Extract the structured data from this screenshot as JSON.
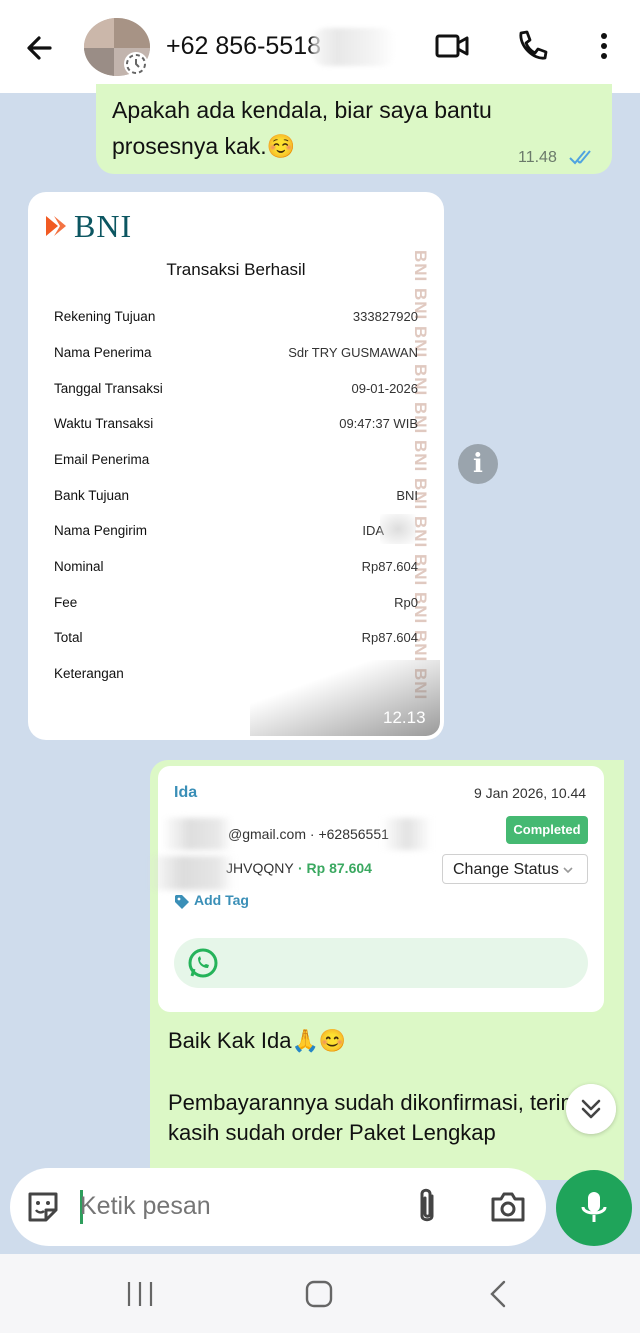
{
  "header": {
    "contact": "+62 856-5518",
    "icons": [
      "back-arrow-icon",
      "avatar",
      "video-call-icon",
      "phone-icon",
      "more-vert-icon"
    ]
  },
  "messages": {
    "outgoing_1": {
      "text": "Apakah ada kendala, biar saya bantu prosesnya kak.☺️",
      "time": "11.48"
    },
    "incoming_receipt": {
      "logo": "BNI",
      "title": "Transaksi Berhasil",
      "rows": [
        {
          "label": "Rekening Tujuan",
          "value": "333827920"
        },
        {
          "label": "Nama Penerima",
          "value": "Sdr TRY GUSMAWAN"
        },
        {
          "label": "Tanggal Transaksi",
          "value": "09-01-2026"
        },
        {
          "label": "Waktu Transaksi",
          "value": "09:47:37 WIB"
        },
        {
          "label": "Email Penerima",
          "value": ""
        },
        {
          "label": "Bank Tujuan",
          "value": "BNI"
        },
        {
          "label": "Nama Pengirim",
          "value": "IDA"
        },
        {
          "label": "Nominal",
          "value": "Rp87.604"
        },
        {
          "label": "Fee",
          "value": "Rp0"
        },
        {
          "label": "Total",
          "value": "Rp87.604"
        },
        {
          "label": "Keterangan",
          "value": ""
        }
      ],
      "watermark": "BNI BNI BNI BNI BNI BNI BNI BNI BNI BNI BNI BNI",
      "time": "12.13"
    },
    "outgoing_2": {
      "card": {
        "name": "Ida",
        "date": "9 Jan 2026, 10.44",
        "email": "@gmail.com · +62856551",
        "status": "Completed",
        "order_code": "JHVQQNY",
        "amount": "· Rp 87.604",
        "change_status": "Change Status",
        "add_tag": "Add Tag"
      },
      "text_1": "Baik Kak Ida🙏😊",
      "text_2": "Pembayarannya sudah dikonfirmasi, terima kasih sudah order Paket Lengkap"
    }
  },
  "composer": {
    "placeholder": "Ketik pesan"
  },
  "colors": {
    "outgoing_bubble": "#dcf8c6",
    "chat_background": "#cfdcec",
    "mic_button": "#1fa45a",
    "read_ticks": "#4fa3e0",
    "completed_badge": "#45b972"
  }
}
